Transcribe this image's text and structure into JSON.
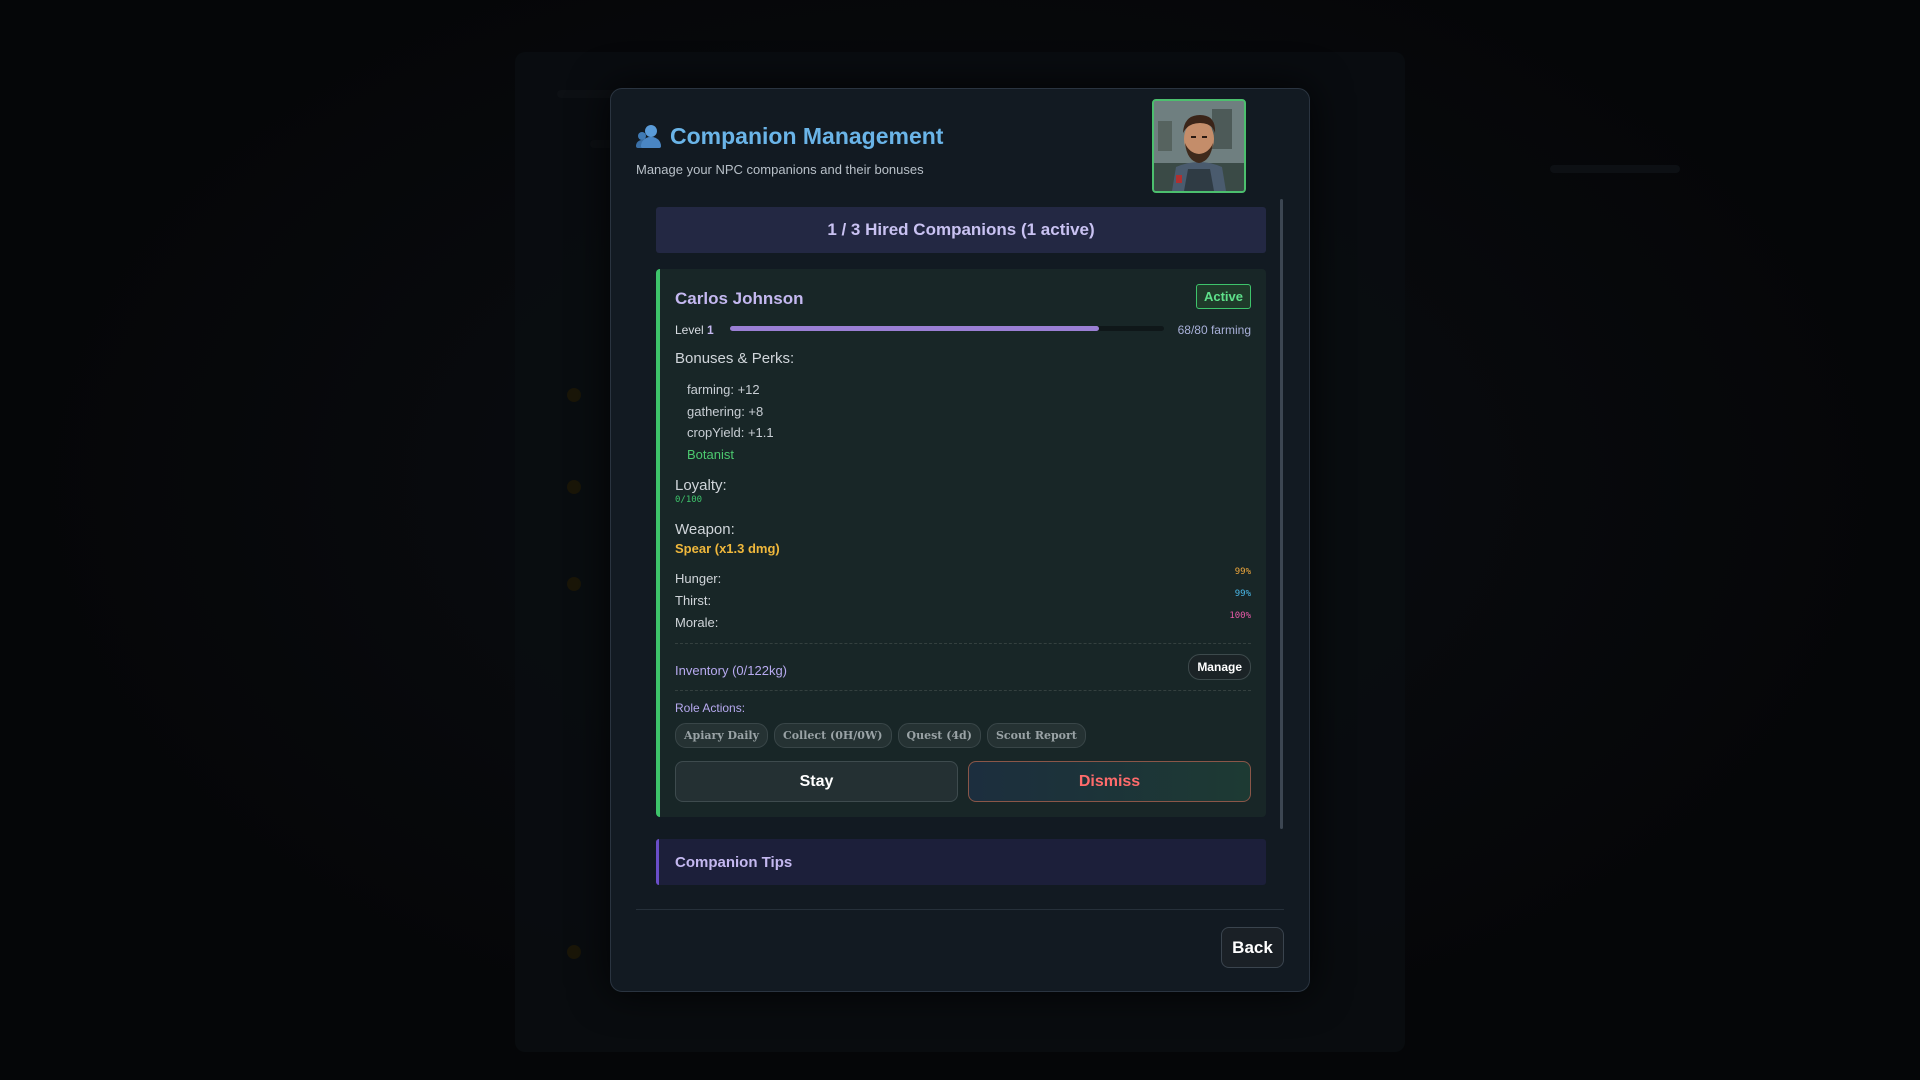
{
  "modal": {
    "title": "Companion Management",
    "subtitle": "Manage your NPC companions and their bonuses",
    "counter": "1 / 3 Hired Companions (1 active)",
    "tips_title": "Companion Tips",
    "back_label": "Back"
  },
  "companion": {
    "name": "Carlos Johnson",
    "status": "Active",
    "level_label": "Level",
    "level": "1",
    "xp_text": "68/80 farming",
    "xp_progress": 0.85,
    "bonuses_label": "Bonuses & Perks:",
    "bonuses": [
      "farming: +12",
      "gathering: +8",
      "cropYield: +1.1"
    ],
    "perk": "Botanist",
    "loyalty_label": "Loyalty:",
    "loyalty_value": "0/100",
    "weapon_label": "Weapon:",
    "weapon_value": "Spear (x1.3 dmg)",
    "stats": [
      {
        "label": "Hunger:",
        "value": "99%",
        "color": "#f0a83c"
      },
      {
        "label": "Thirst:",
        "value": "99%",
        "color": "#4ab8e8"
      },
      {
        "label": "Morale:",
        "value": "100%",
        "color": "#e85aa8"
      }
    ],
    "inventory_label": "Inventory (0/122kg)",
    "manage_label": "Manage",
    "role_actions_label": "Role Actions:",
    "role_actions": [
      "Apiary Daily",
      "Collect (0H/0W)",
      "Quest (4d)",
      "Scout Report"
    ],
    "stay_label": "Stay",
    "dismiss_label": "Dismiss"
  },
  "colors": {
    "accent_title": "#6ab4e8",
    "active_green": "#3ec46b",
    "dismiss_red": "#ff6b6b",
    "weapon_gold": "#f0b83c"
  }
}
